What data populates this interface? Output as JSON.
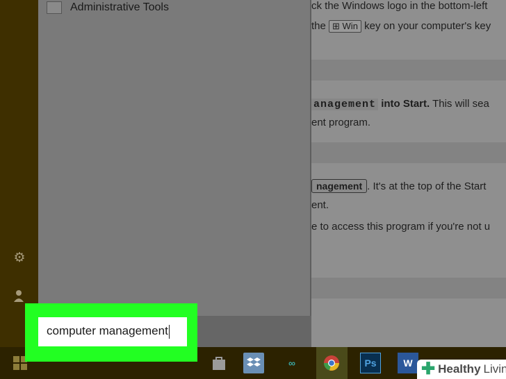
{
  "panel": {
    "item_label": "Administrative Tools"
  },
  "search": {
    "value": "computer management"
  },
  "article": {
    "line1": "ck the Windows logo in the bottom-left",
    "line2_pre": "the",
    "line2_key": "⊞ Win",
    "line2_post": "key on your computer's key",
    "line3_code": "anagement",
    "line3_bold": "into Start.",
    "line3_rest": "This will sea",
    "line4": "ent program.",
    "line5_pill": "nagement",
    "line5_rest": ". It's at the top of the Start",
    "line6": "ent.",
    "line7": "e to access this program if you're not u"
  },
  "taskbar": {
    "ps_label": "Ps",
    "word_label": "W"
  },
  "brand": {
    "name_bold": "Healthy",
    "name_rest": "Living"
  },
  "colors": {
    "highlight": "#22ff22",
    "rail": "#3e2f00",
    "taskbar": "#2c2200"
  }
}
